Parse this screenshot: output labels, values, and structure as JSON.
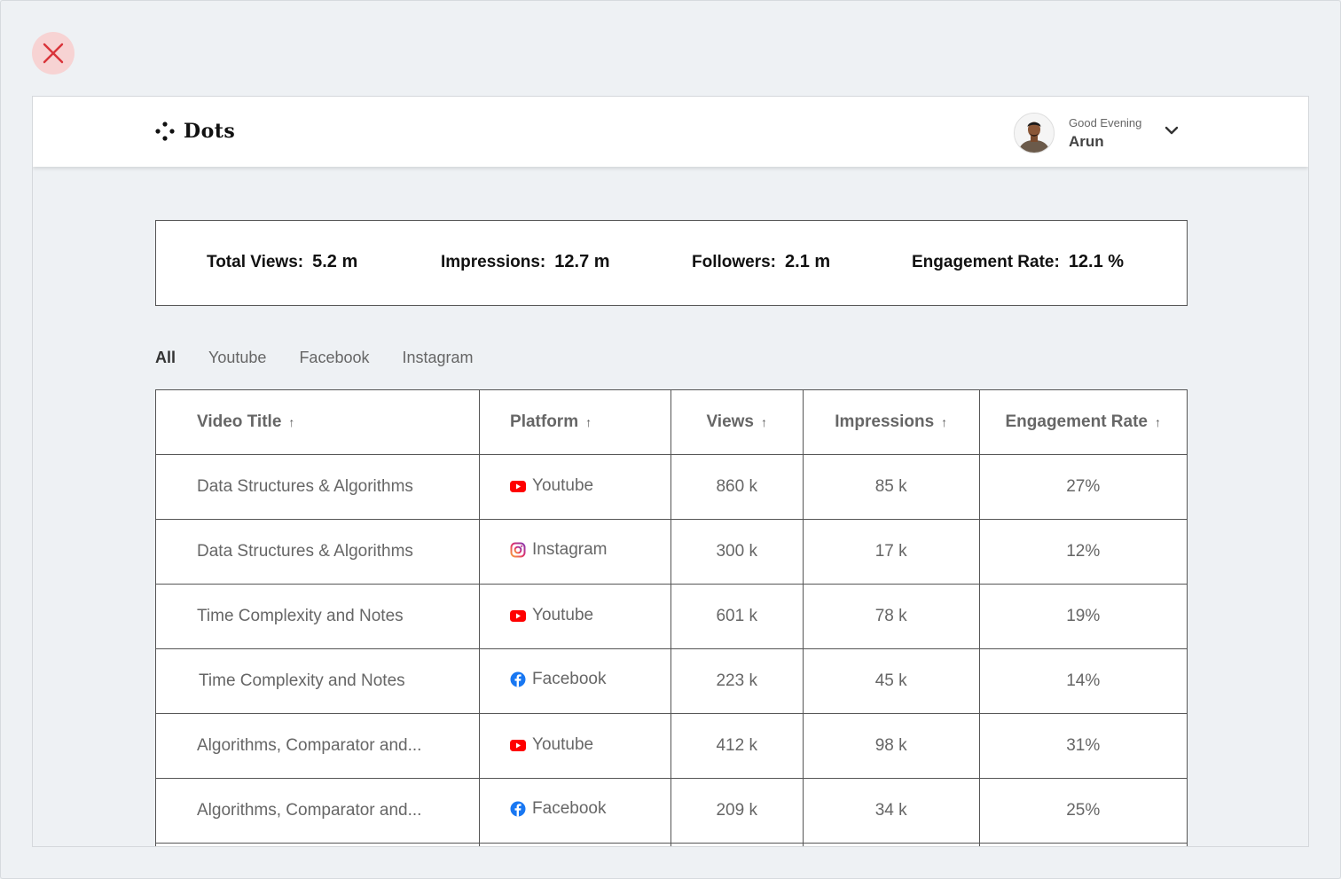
{
  "app": {
    "brand": "Dots"
  },
  "user": {
    "greeting": "Good Evening",
    "name": "Arun"
  },
  "stats": [
    {
      "label": "Total Views:",
      "value": "5.2 m"
    },
    {
      "label": "Impressions:",
      "value": "12.7 m"
    },
    {
      "label": "Followers:",
      "value": "2.1 m"
    },
    {
      "label": "Engagement Rate:",
      "value": "12.1 %"
    }
  ],
  "tabs": [
    {
      "label": "All",
      "active": true
    },
    {
      "label": "Youtube",
      "active": false
    },
    {
      "label": "Facebook",
      "active": false
    },
    {
      "label": "Instagram",
      "active": false
    }
  ],
  "table": {
    "sort_glyph": "↑",
    "headers": [
      "Video Title",
      "Platform",
      "Views",
      "Impressions",
      "Engagement Rate"
    ],
    "rows": [
      {
        "title": "Data Structures & Algorithms",
        "platform": "Youtube",
        "icon": "youtube-icon",
        "views": "860 k",
        "impressions": "85 k",
        "engagement": "27%"
      },
      {
        "title": "Data Structures & Algorithms",
        "platform": "Instagram",
        "icon": "instagram-icon",
        "views": "300 k",
        "impressions": "17 k",
        "engagement": "12%"
      },
      {
        "title": "Time Complexity and Notes",
        "platform": "Youtube",
        "icon": "youtube-icon",
        "views": "601 k",
        "impressions": "78 k",
        "engagement": "19%"
      },
      {
        "title": "Time Complexity and Notes",
        "platform": "Facebook",
        "icon": "facebook-icon",
        "views": "223 k",
        "impressions": "45 k",
        "engagement": "14%"
      },
      {
        "title": "Algorithms, Comparator and...",
        "platform": "Youtube",
        "icon": "youtube-icon",
        "views": "412 k",
        "impressions": "98 k",
        "engagement": "31%"
      },
      {
        "title": "Algorithms, Comparator and...",
        "platform": "Facebook",
        "icon": "facebook-icon",
        "views": "209 k",
        "impressions": "34 k",
        "engagement": "25%"
      },
      {
        "title": "",
        "platform": "",
        "icon": "",
        "views": "",
        "impressions": "",
        "engagement": ""
      }
    ]
  },
  "colors": {
    "close_bg": "#f7d3d3",
    "close_x": "#d9343a",
    "youtube": "#ff0000",
    "facebook": "#1877f2",
    "page_bg": "#eef1f4"
  }
}
